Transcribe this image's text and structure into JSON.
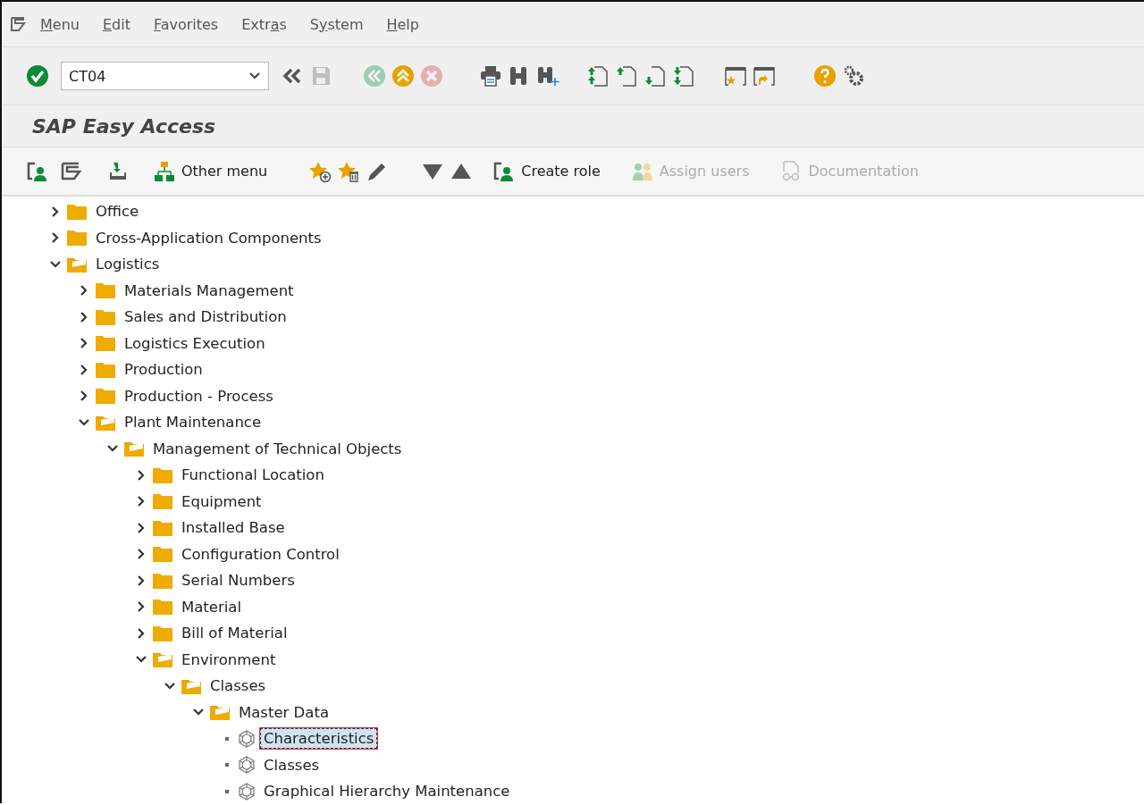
{
  "menu_bar": [
    {
      "access_key": "M",
      "rest": "enu"
    },
    {
      "access_key": "E",
      "rest": "dit"
    },
    {
      "access_key": "F",
      "rest": "avorites"
    },
    {
      "start": "Extr",
      "access_key": "a",
      "rest": "s"
    },
    {
      "start": "S",
      "access_key": "y",
      "rest": "stem"
    },
    {
      "access_key": "H",
      "rest": "elp"
    }
  ],
  "system_toolbar": {
    "command_field": {
      "value": "CT04"
    },
    "buttons": [
      {
        "kind": "enter",
        "disabled": false
      },
      {
        "kind": "field"
      },
      {
        "kind": "collapse",
        "disabled": false
      },
      {
        "kind": "save",
        "disabled": true
      },
      {
        "kind": "back",
        "disabled": true
      },
      {
        "kind": "exit",
        "disabled": false
      },
      {
        "kind": "cancel",
        "disabled": true
      },
      {
        "kind": "print",
        "disabled": false
      },
      {
        "kind": "find",
        "disabled": false
      },
      {
        "kind": "find-next",
        "disabled": false
      },
      {
        "kind": "first-page",
        "disabled": false
      },
      {
        "kind": "previous-page",
        "disabled": false
      },
      {
        "kind": "next-page",
        "disabled": false
      },
      {
        "kind": "last-page",
        "disabled": false
      },
      {
        "kind": "new-session",
        "disabled": false
      },
      {
        "kind": "shortcut",
        "disabled": false
      },
      {
        "kind": "help",
        "disabled": false
      },
      {
        "kind": "customize",
        "disabled": false
      }
    ]
  },
  "title": "SAP Easy Access",
  "app_toolbar": [
    {
      "kind": "user-menu",
      "disabled": false
    },
    {
      "kind": "sap-menu",
      "disabled": false
    },
    {
      "kind": "download",
      "disabled": false
    },
    {
      "kind": "other-menu",
      "label": "Other menu",
      "disabled": false
    },
    {
      "kind": "add-favorite",
      "disabled": false
    },
    {
      "kind": "delete-favorite",
      "disabled": false
    },
    {
      "kind": "edit",
      "disabled": false
    },
    {
      "kind": "move-down",
      "disabled": false
    },
    {
      "kind": "move-up",
      "disabled": false
    },
    {
      "kind": "create-role",
      "label": "Create role",
      "disabled": false
    },
    {
      "kind": "assign-users",
      "label": "Assign users",
      "disabled": true
    },
    {
      "kind": "documentation",
      "label": "Documentation",
      "disabled": true
    }
  ],
  "tree": [
    {
      "label": "Office",
      "kind": "folder",
      "expanded": false,
      "selected": false
    },
    {
      "label": "Cross-Application Components",
      "kind": "folder",
      "expanded": false,
      "selected": false
    },
    {
      "label": "Logistics",
      "kind": "folder",
      "expanded": true,
      "selected": false,
      "children": [
        {
          "label": "Materials Management",
          "kind": "folder",
          "expanded": false,
          "selected": false
        },
        {
          "label": "Sales and Distribution",
          "kind": "folder",
          "expanded": false,
          "selected": false
        },
        {
          "label": "Logistics Execution",
          "kind": "folder",
          "expanded": false,
          "selected": false
        },
        {
          "label": "Production",
          "kind": "folder",
          "expanded": false,
          "selected": false
        },
        {
          "label": "Production - Process",
          "kind": "folder",
          "expanded": false,
          "selected": false
        },
        {
          "label": "Plant Maintenance",
          "kind": "folder",
          "expanded": true,
          "selected": false,
          "children": [
            {
              "label": "Management of Technical Objects",
              "kind": "folder",
              "expanded": true,
              "selected": false,
              "children": [
                {
                  "label": "Functional Location",
                  "kind": "folder",
                  "expanded": false,
                  "selected": false
                },
                {
                  "label": "Equipment",
                  "kind": "folder",
                  "expanded": false,
                  "selected": false
                },
                {
                  "label": "Installed Base",
                  "kind": "folder",
                  "expanded": false,
                  "selected": false
                },
                {
                  "label": "Configuration Control",
                  "kind": "folder",
                  "expanded": false,
                  "selected": false
                },
                {
                  "label": "Serial Numbers",
                  "kind": "folder",
                  "expanded": false,
                  "selected": false
                },
                {
                  "label": "Material",
                  "kind": "folder",
                  "expanded": false,
                  "selected": false
                },
                {
                  "label": "Bill of Material",
                  "kind": "folder",
                  "expanded": false,
                  "selected": false
                },
                {
                  "label": "Environment",
                  "kind": "folder",
                  "expanded": true,
                  "selected": false,
                  "children": [
                    {
                      "label": "Classes",
                      "kind": "folder",
                      "expanded": true,
                      "selected": false,
                      "children": [
                        {
                          "label": "Master Data",
                          "kind": "folder",
                          "expanded": true,
                          "selected": false,
                          "children": [
                            {
                              "label": "Characteristics",
                              "kind": "transaction",
                              "selected": true
                            },
                            {
                              "label": "Classes",
                              "kind": "transaction",
                              "selected": false
                            },
                            {
                              "label": "Graphical Hierarchy Maintenance",
                              "kind": "transaction",
                              "selected": false
                            }
                          ]
                        }
                      ]
                    }
                  ]
                }
              ]
            }
          ]
        }
      ]
    }
  ]
}
